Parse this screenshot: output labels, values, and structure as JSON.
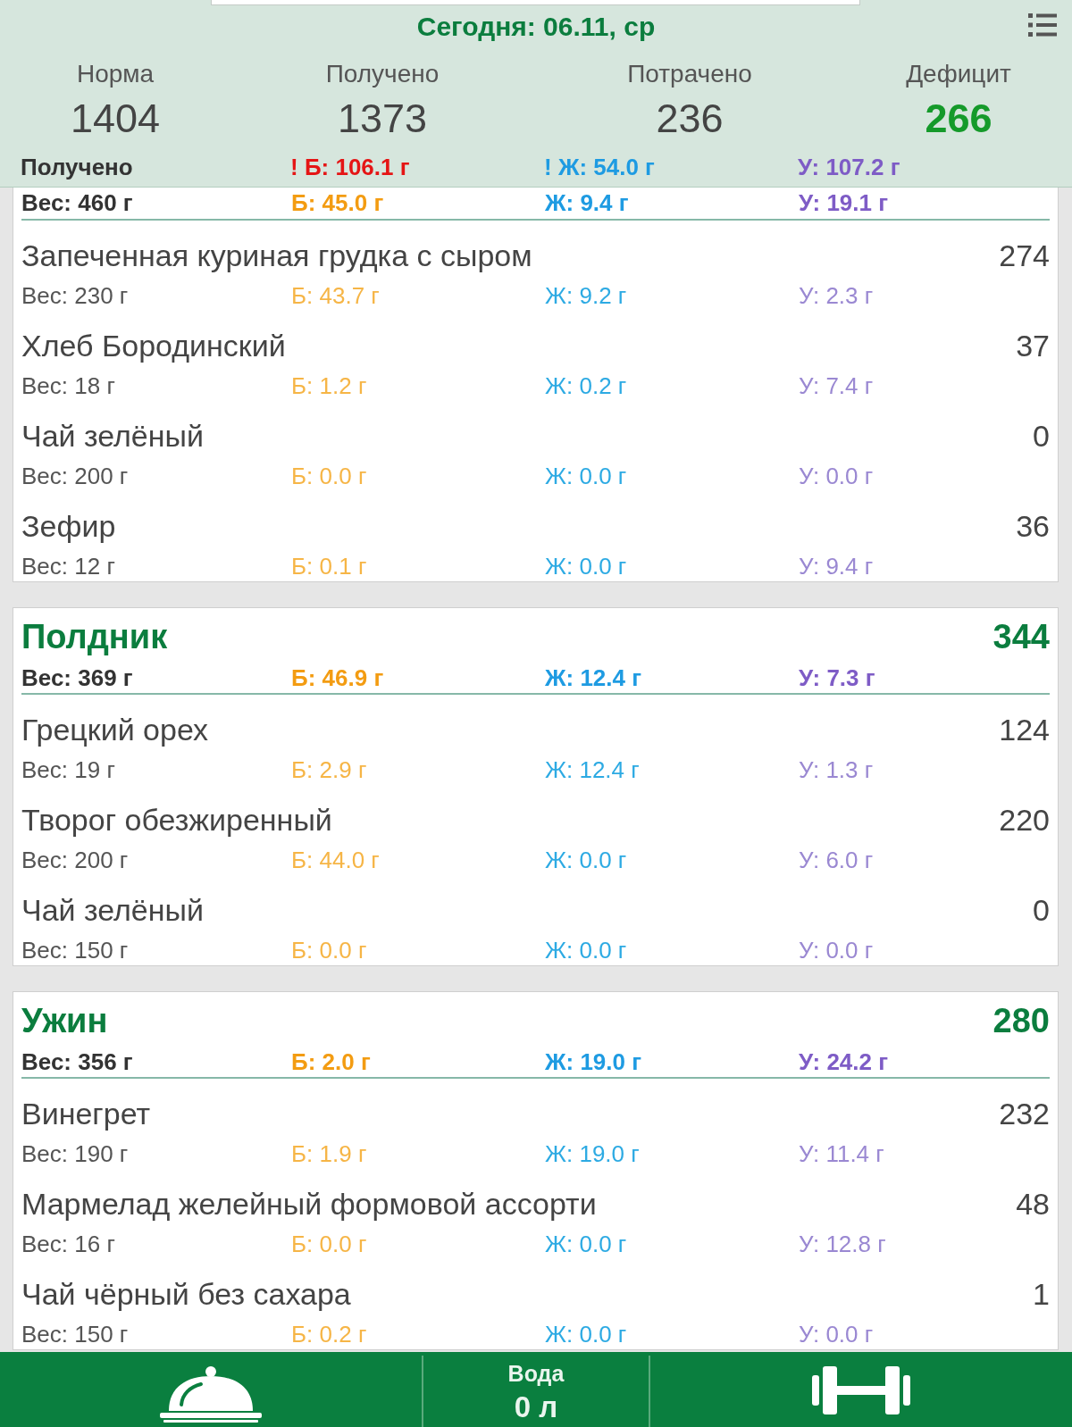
{
  "header": {
    "title": "Сегодня: 06.11, ср",
    "stats": [
      {
        "label": "Норма",
        "value": "1404",
        "highlight": false
      },
      {
        "label": "Получено",
        "value": "1373",
        "highlight": false
      },
      {
        "label": "Потрачено",
        "value": "236",
        "highlight": false
      },
      {
        "label": "Дефицит",
        "value": "266",
        "highlight": true
      }
    ],
    "received": {
      "label": "Получено",
      "macros": [
        {
          "kind": "protein",
          "text": "! Б: 106.1 г",
          "exceeded": true
        },
        {
          "kind": "fat",
          "text": "! Ж: 54.0 г",
          "exceeded": false
        },
        {
          "kind": "carbs",
          "text": "У: 107.2 г",
          "exceeded": false
        }
      ]
    }
  },
  "meals": [
    {
      "weight": "Вес: 460 г",
      "protein": "Б: 45.0 г",
      "fat": "Ж: 9.4 г",
      "carbs": "У: 19.1 г",
      "items": [
        {
          "name": "Запеченная куриная грудка с сыром",
          "calories": "274",
          "weight": "Вес: 230 г",
          "protein": "Б: 43.7 г",
          "fat": "Ж: 9.2 г",
          "carbs": "У: 2.3 г"
        },
        {
          "name": "Хлеб Бородинский",
          "calories": "37",
          "weight": "Вес: 18 г",
          "protein": "Б: 1.2 г",
          "fat": "Ж: 0.2 г",
          "carbs": "У: 7.4 г"
        },
        {
          "name": "Чай зелёный",
          "calories": "0",
          "weight": "Вес: 200 г",
          "protein": "Б: 0.0 г",
          "fat": "Ж: 0.0 г",
          "carbs": "У: 0.0 г"
        },
        {
          "name": "Зефир",
          "calories": "36",
          "weight": "Вес: 12 г",
          "protein": "Б: 0.1 г",
          "fat": "Ж: 0.0 г",
          "carbs": "У: 9.4 г"
        }
      ]
    },
    {
      "title": "Полдник",
      "calories": "344",
      "weight": "Вес: 369 г",
      "protein": "Б: 46.9 г",
      "fat": "Ж: 12.4 г",
      "carbs": "У: 7.3 г",
      "items": [
        {
          "name": "Грецкий орех",
          "calories": "124",
          "weight": "Вес: 19 г",
          "protein": "Б: 2.9 г",
          "fat": "Ж: 12.4 г",
          "carbs": "У: 1.3 г"
        },
        {
          "name": "Творог обезжиренный",
          "calories": "220",
          "weight": "Вес: 200 г",
          "protein": "Б: 44.0 г",
          "fat": "Ж: 0.0 г",
          "carbs": "У: 6.0 г"
        },
        {
          "name": "Чай зелёный",
          "calories": "0",
          "weight": "Вес: 150 г",
          "protein": "Б: 0.0 г",
          "fat": "Ж: 0.0 г",
          "carbs": "У: 0.0 г"
        }
      ]
    },
    {
      "title": "Ужин",
      "calories": "280",
      "weight": "Вес: 356 г",
      "protein": "Б: 2.0 г",
      "fat": "Ж: 19.0 г",
      "carbs": "У: 24.2 г",
      "items": [
        {
          "name": "Винегрет",
          "calories": "232",
          "weight": "Вес: 190 г",
          "protein": "Б: 1.9 г",
          "fat": "Ж: 19.0 г",
          "carbs": "У: 11.4 г"
        },
        {
          "name": "Мармелад желейный формовой ассорти",
          "calories": "48",
          "weight": "Вес: 16 г",
          "protein": "Б: 0.0 г",
          "fat": "Ж: 0.0 г",
          "carbs": "У: 12.8 г"
        },
        {
          "name": "Чай чёрный без сахара",
          "calories": "1",
          "weight": "Вес: 150 г",
          "protein": "Б: 0.2 г",
          "fat": "Ж: 0.0 г",
          "carbs": "У: 0.0 г"
        }
      ]
    }
  ],
  "bottom_bar": {
    "water_label": "Вода",
    "water_value": "0 л"
  }
}
